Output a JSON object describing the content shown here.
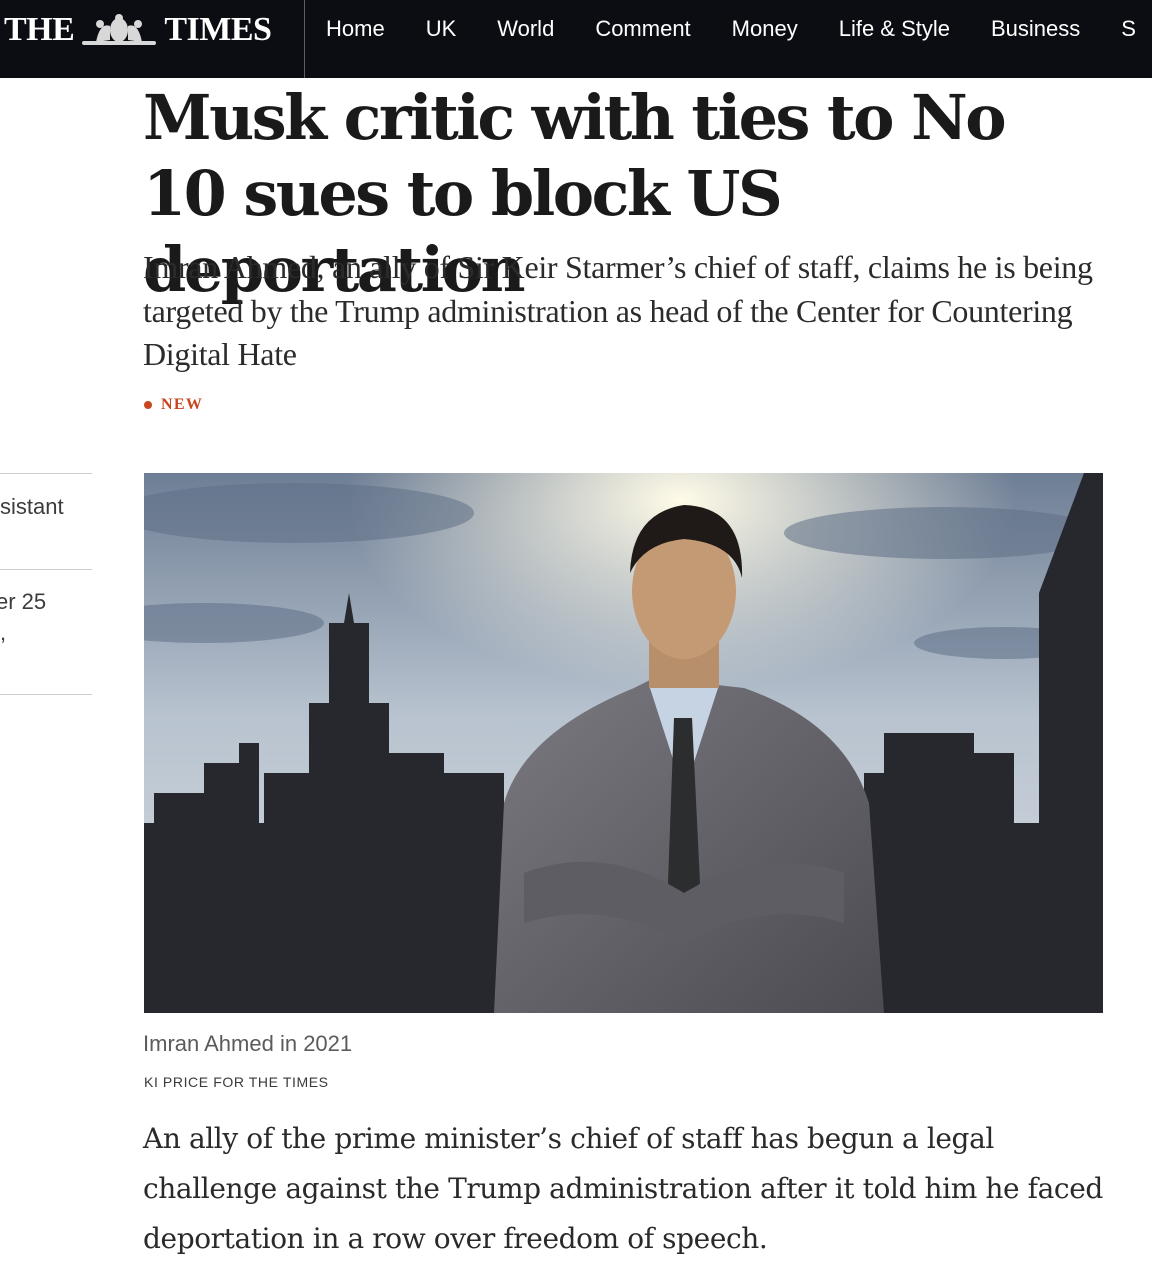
{
  "nav": {
    "logo_left": "THE",
    "logo_right": "TIMES",
    "items": [
      "Home",
      "UK",
      "World",
      "Comment",
      "Money",
      "Life & Style",
      "Business",
      "S"
    ]
  },
  "left_rail": {
    "item1": "sistant",
    "item2_line1": "er 25",
    "item2_line2": ","
  },
  "article": {
    "headline": "Musk critic with ties to No 10 sues to block US deportation",
    "standfirst": "Imran Ahmed, an ally of Sir Keir Starmer’s chief of staff, claims he is being targeted by the Trump administration as head of the Center for Countering Digital Hate",
    "badge": "NEW",
    "image_caption": "Imran Ahmed in 2021",
    "image_credit": "KI PRICE FOR THE TIMES",
    "body": "An ally of the prime minister’s chief of staff has begun a legal challenge against the Trump administration after it told him he faced deportation in a row over freedom of speech."
  },
  "colors": {
    "nav_bg": "#0b0d13",
    "badge": "#c8451d",
    "text": "#1a1a1a"
  }
}
